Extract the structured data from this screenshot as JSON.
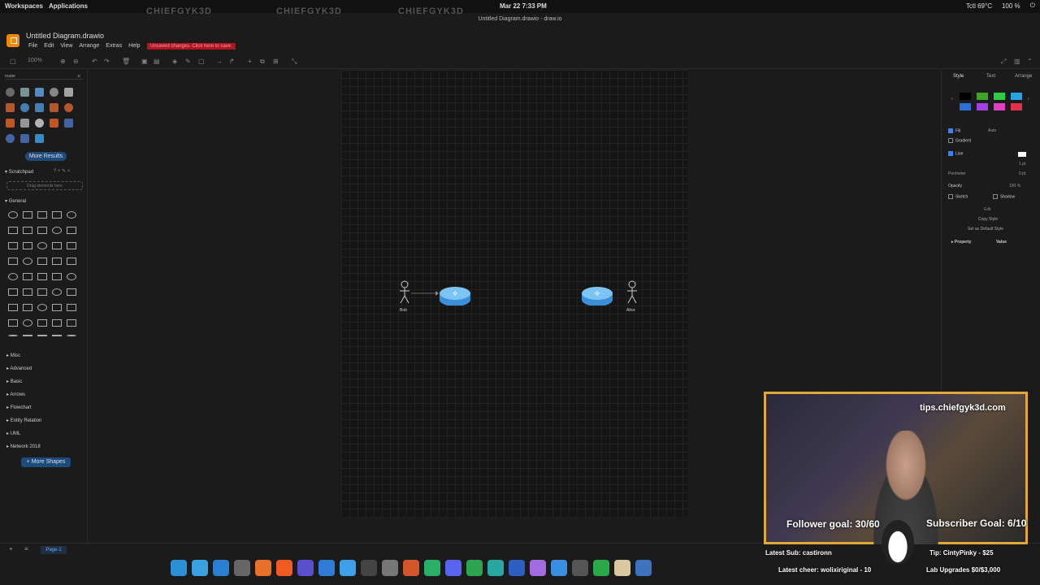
{
  "top": {
    "workspaces": "Workspaces",
    "applications": "Applications",
    "clock": "Mar 22  7:33 PM",
    "temp": "Tctl 69°C",
    "battery": "100 %"
  },
  "watermarks": [
    "CHIEFGYK3D",
    "CHIEFGYK3D",
    "CHIEFGYK3D"
  ],
  "window_title": "Untitled Diagram.drawio - draw.io",
  "app": {
    "title": "Untitled Diagram.drawio",
    "menus": [
      "File",
      "Edit",
      "View",
      "Arrange",
      "Extras",
      "Help"
    ],
    "unsaved": "Unsaved changes. Click here to save."
  },
  "toolbar": {
    "zoom": "100%"
  },
  "left": {
    "search": "router",
    "more_results": "More Results",
    "scratchpad": "Scratchpad",
    "drag_hint": "Drag elements here",
    "general": "General",
    "categories": [
      "Misc",
      "Advanced",
      "Basic",
      "Arrows",
      "Flowchart",
      "Entity Relation",
      "UML",
      "Network 2018"
    ],
    "more_shapes": "+ More Shapes"
  },
  "canvas": {
    "actor_left": "Bob",
    "actor_right": "Alice"
  },
  "right": {
    "tabs": [
      "Style",
      "Text",
      "Arrange"
    ],
    "fill": "Fill",
    "fill_value": "Auto",
    "gradient": "Gradient",
    "line": "Line",
    "line_width": "1 pt",
    "perimeter": "Perimeter",
    "perimeter_value": "0 pt",
    "opacity": "Opacity",
    "opacity_value": "100 %",
    "sketch": "Sketch",
    "shadow": "Shadow",
    "edit": "Edit",
    "copy_style": "Copy Style",
    "set_default": "Set as Default Style",
    "property": "Property",
    "value": "Value",
    "swatches": [
      "#000000",
      "#3fa32a",
      "#2ecc40",
      "#29a3e0",
      "#2b6fd8",
      "#a040e0",
      "#e040c0",
      "#e0304a"
    ]
  },
  "bottom": {
    "page": "Page-1"
  },
  "stream": {
    "tips": "tips.chiefgyk3d.com",
    "follower": "Follower goal: 30/60",
    "subscriber": "Subscriber Goal: 6/10",
    "latest_sub": "Latest Sub: castironn",
    "tip": "Tip: CintyPinky - $25",
    "latest_cheer": "Latest cheer: wolixiriginal - 10",
    "lab": "Lab Upgrades $0/$3,000"
  },
  "dock": {
    "colors": [
      "#2b8fd6",
      "#3aa0e0",
      "#2a7fd0",
      "#666",
      "#e8702a",
      "#f25a22",
      "#5a4fcf",
      "#2f7bd6",
      "#3ea0e8",
      "#444",
      "#777",
      "#d4552a",
      "#2bb06a",
      "#5865f2",
      "#2da44e",
      "#2aa6a0",
      "#2c5fbf",
      "#a46be0",
      "#3b8fe0",
      "#555",
      "#2aa84a",
      "#d9c9a0",
      "#3b73c0"
    ]
  }
}
